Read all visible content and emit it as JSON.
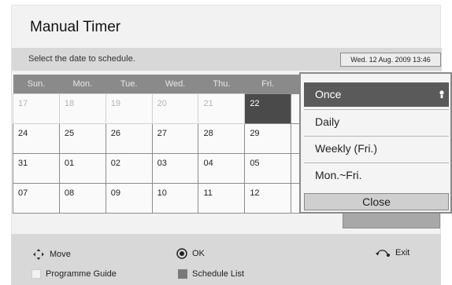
{
  "header": {
    "title": "Manual Timer"
  },
  "instruction": "Select the date to schedule.",
  "datetime": "Wed. 12 Aug. 2009 13:46",
  "calendar": {
    "days": [
      "Sun.",
      "Mon.",
      "Tue.",
      "Wed.",
      "Thu.",
      "Fri.",
      ""
    ],
    "rows": [
      [
        "17",
        "18",
        "19",
        "20",
        "21",
        "22",
        ""
      ],
      [
        "24",
        "25",
        "26",
        "27",
        "28",
        "29",
        ""
      ],
      [
        "31",
        "01",
        "02",
        "03",
        "04",
        "05",
        ""
      ],
      [
        "07",
        "08",
        "09",
        "10",
        "11",
        "12",
        ""
      ]
    ],
    "selected": "22"
  },
  "repeat_menu": {
    "options": [
      "Once",
      "Daily",
      "Weekly (Fri.)",
      "Mon.~Fri."
    ],
    "selected": "Once",
    "close_label": "Close"
  },
  "footer": {
    "move": "Move",
    "ok": "OK",
    "exit": "Exit",
    "programme_guide": "Programme Guide",
    "schedule_list": "Schedule List"
  },
  "colors": {
    "header_bg": "#8a8a8a",
    "selected_bg": "#4a4a4a",
    "programme_guide_key": "#f2f2f2",
    "schedule_list_key": "#7a7a7a"
  }
}
